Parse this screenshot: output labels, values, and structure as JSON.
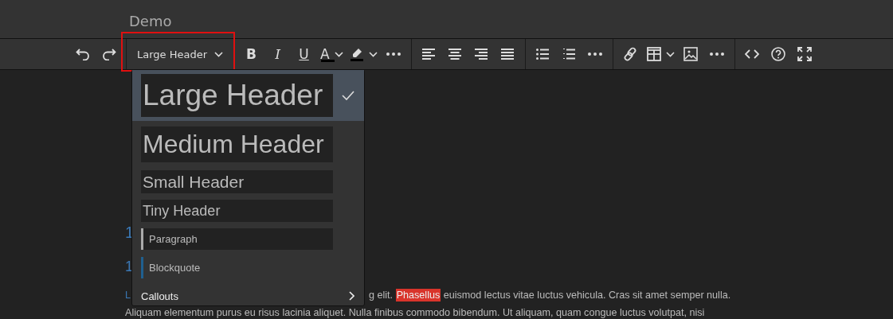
{
  "title": "Demo",
  "toolbar": [
    {
      "outlined": false,
      "items": [
        {
          "kind": "undo"
        },
        {
          "kind": "redo"
        }
      ]
    },
    {
      "outlined": true,
      "items": [
        {
          "kind": "format",
          "label": "Large Header",
          "dropdown": true
        }
      ]
    },
    {
      "outlined": false,
      "items": [
        {
          "kind": "bold",
          "glyph": "B"
        },
        {
          "kind": "italic",
          "glyph": "I"
        },
        {
          "kind": "underline",
          "glyph": "U"
        },
        {
          "kind": "text-color",
          "glyph": "A",
          "dropdown": true
        },
        {
          "kind": "highlight",
          "dropdown": true
        },
        {
          "kind": "more"
        }
      ]
    },
    {
      "outlined": false,
      "items": [
        {
          "kind": "align-left"
        },
        {
          "kind": "align-center"
        },
        {
          "kind": "align-right"
        },
        {
          "kind": "justify"
        }
      ]
    },
    {
      "outlined": false,
      "items": [
        {
          "kind": "bullets"
        },
        {
          "kind": "numbered"
        },
        {
          "kind": "more"
        }
      ]
    },
    {
      "outlined": false,
      "items": [
        {
          "kind": "link"
        },
        {
          "kind": "table",
          "dropdown": true
        },
        {
          "kind": "image"
        },
        {
          "kind": "more"
        }
      ]
    },
    {
      "outlined": false,
      "items": [
        {
          "kind": "code"
        },
        {
          "kind": "help"
        },
        {
          "kind": "fullscreen"
        }
      ]
    }
  ],
  "content": {
    "headings": [
      {
        "kind": "h3",
        "text": "1"
      },
      {
        "kind": "h4",
        "text": "1"
      }
    ],
    "lines": [
      {
        "lead": "L",
        "text": "g elit. **Phasellus** euismod lectus vitae luctus vehicula. Cras sit amet semper nulla."
      },
      {
        "text": "Aliquam elementum purus eu risus lacinia aliquet. Nulla finibus commodo bibendum. Ut aliquam, quam congue luctus volutpat, nisi"
      }
    ]
  },
  "menu": [
    {
      "kind": "large",
      "label": "Large Header",
      "selected": true
    },
    {
      "kind": "medium",
      "label": "Medium Header",
      "selected": false
    },
    {
      "kind": "small",
      "label": "Small Header",
      "selected": false
    },
    {
      "kind": "tiny",
      "label": "Tiny Header",
      "selected": false
    },
    {
      "kind": "paragraph",
      "label": "Paragraph",
      "selected": false
    },
    {
      "kind": "blockquote",
      "label": "Blockquote",
      "selected": false
    },
    {
      "kind": "submenu",
      "label": "Callouts",
      "selected": false
    }
  ]
}
